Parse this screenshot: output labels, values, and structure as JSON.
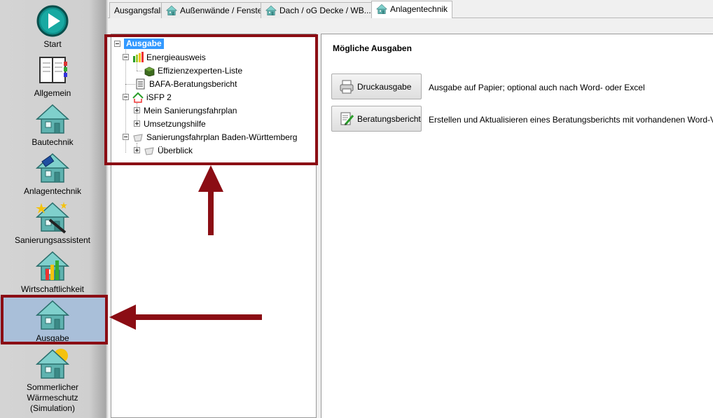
{
  "sidebar": {
    "items": [
      {
        "label": "Start"
      },
      {
        "label": "Allgemein"
      },
      {
        "label": "Bautechnik"
      },
      {
        "label": "Anlagentechnik"
      },
      {
        "label": "Sanierungsassistent"
      },
      {
        "label": "Wirtschaftlichkeit"
      },
      {
        "label": "Ausgabe"
      },
      {
        "label_line1": "Sommerlicher",
        "label_line2": "Wärmeschutz",
        "label_line3": "(Simulation)"
      }
    ],
    "selected": "Ausgabe"
  },
  "tabs": [
    {
      "label": "Ausgangsfall"
    },
    {
      "label": "Außenwände / Fenster"
    },
    {
      "label": "Dach / oG Decke / WB..."
    },
    {
      "label": "Anlagentechnik"
    }
  ],
  "tree": {
    "root": "Ausgabe",
    "items": [
      {
        "label": "Energieausweis"
      },
      {
        "label": "Effizienzexperten-Liste"
      },
      {
        "label": "BAFA-Beratungsbericht"
      },
      {
        "label": "iSFP 2"
      },
      {
        "label": "Mein Sanierungsfahrplan"
      },
      {
        "label": "Umsetzungshilfe"
      },
      {
        "label": "Sanierungsfahrplan Baden-Württemberg"
      },
      {
        "label": "Überblick"
      }
    ]
  },
  "main": {
    "title": "Mögliche Ausgaben",
    "actions": [
      {
        "label": "Druckausgabe",
        "description": "Ausgabe auf Papier; optional auch nach Word- oder Excel"
      },
      {
        "label": "Beratungsbericht",
        "description": "Erstellen und Aktualisieren eines Beratungsberichts mit vorhandenen Word-Vorlagen"
      }
    ]
  },
  "colors": {
    "annotation": "#8b0d14",
    "selection": "#3399ff",
    "sidebar_selected": "#a9bfd9"
  }
}
